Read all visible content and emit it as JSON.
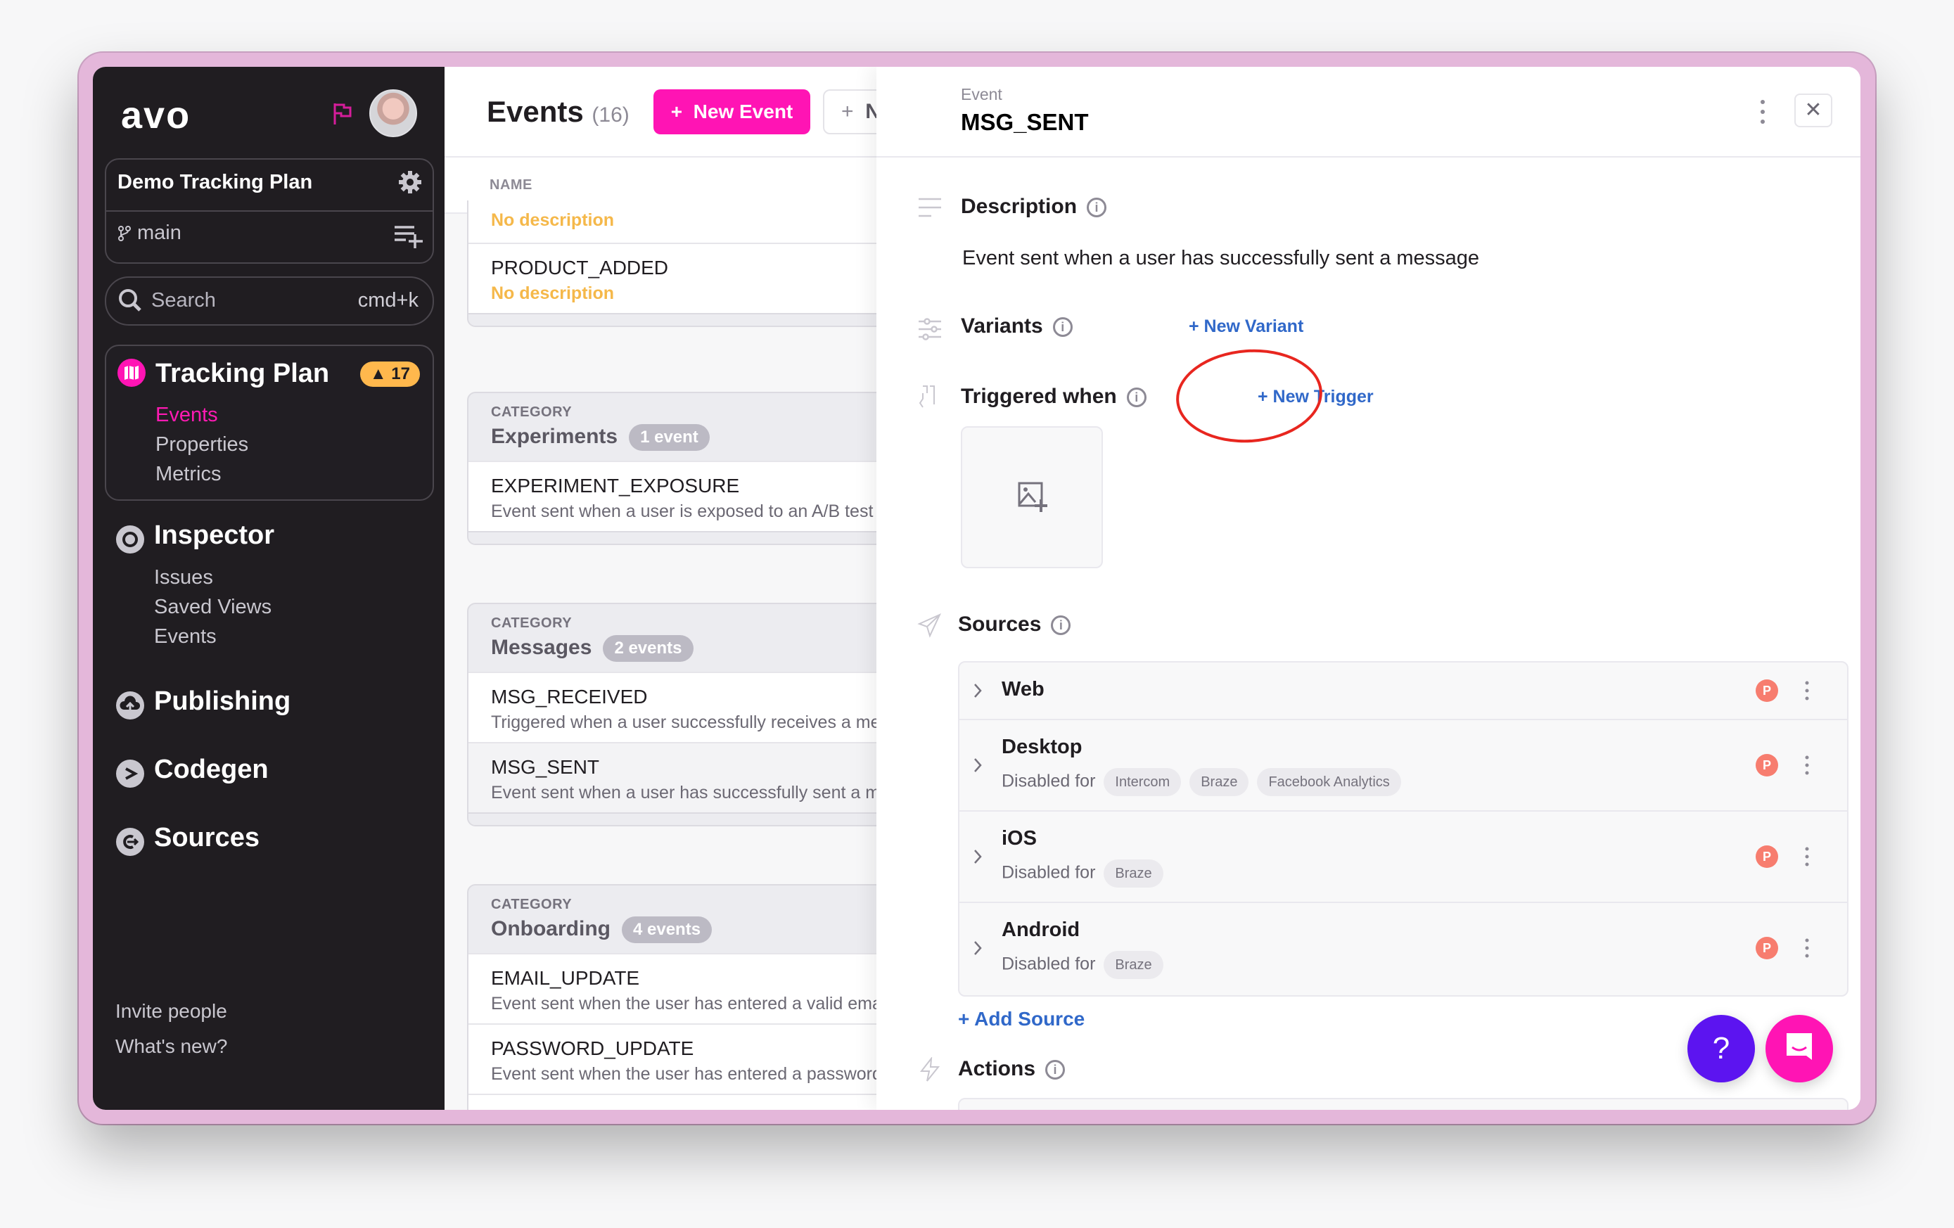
{
  "sidebar": {
    "logo": "avo",
    "plan_name": "Demo Tracking Plan",
    "branch": "main",
    "search": {
      "placeholder": "Search",
      "shortcut": "cmd+k"
    },
    "tracking_plan": {
      "title": "Tracking Plan",
      "issues_count": "17",
      "items": [
        {
          "label": "Events",
          "active": true
        },
        {
          "label": "Properties",
          "active": false
        },
        {
          "label": "Metrics",
          "active": false
        }
      ]
    },
    "inspector": {
      "title": "Inspector",
      "items": [
        {
          "label": "Issues"
        },
        {
          "label": "Saved Views"
        },
        {
          "label": "Events"
        }
      ]
    },
    "publishing": {
      "title": "Publishing"
    },
    "codegen": {
      "title": "Codegen"
    },
    "sources": {
      "title": "Sources"
    },
    "footer": {
      "invite": "Invite people",
      "whats_new": "What's new?"
    }
  },
  "events_list": {
    "title": "Events",
    "count": "(16)",
    "new_event_label": "New Event",
    "secondary_button_label": "N",
    "column_header": "NAME",
    "top_group": {
      "partial_desc": "No description",
      "events": [
        {
          "name": "PRODUCT_ADDED",
          "description": "No description",
          "no_description": true
        }
      ]
    },
    "categories": [
      {
        "label": "CATEGORY",
        "name": "Experiments",
        "count": "1 event",
        "events": [
          {
            "name": "EXPERIMENT_EXPOSURE",
            "description": "Event sent when a user is exposed to an A/B test"
          }
        ]
      },
      {
        "label": "CATEGORY",
        "name": "Messages",
        "count": "2 events",
        "events": [
          {
            "name": "MSG_RECEIVED",
            "description": "Triggered when a user successfully receives a message"
          },
          {
            "name": "MSG_SENT",
            "description": "Event sent when a user has successfully sent a message",
            "selected": true
          }
        ]
      },
      {
        "label": "CATEGORY",
        "name": "Onboarding",
        "count": "4 events",
        "events": [
          {
            "name": "EMAIL_UPDATE",
            "description": "Event sent when the user has entered a valid email"
          },
          {
            "name": "PASSWORD_UPDATE",
            "description": "Event sent when the user has entered a password"
          }
        ]
      }
    ]
  },
  "panel": {
    "kicker": "Event",
    "title": "MSG_SENT",
    "close_label": "✕",
    "description": {
      "label": "Description",
      "text": "Event sent when a user has successfully sent a message"
    },
    "variants": {
      "label": "Variants",
      "action": "+ New Variant"
    },
    "triggers": {
      "label": "Triggered when",
      "action": "+ New Trigger"
    },
    "sources": {
      "label": "Sources",
      "add_action": "+ Add Source",
      "disabled_prefix": "Disabled for",
      "items": [
        {
          "name": "Web",
          "badge": "P",
          "disabled_for": []
        },
        {
          "name": "Desktop",
          "badge": "P",
          "disabled_for": [
            "Intercom",
            "Braze",
            "Facebook Analytics"
          ]
        },
        {
          "name": "iOS",
          "badge": "P",
          "disabled_for": [
            "Braze"
          ]
        },
        {
          "name": "Android",
          "badge": "P",
          "disabled_for": [
            "Braze"
          ]
        }
      ]
    },
    "actions": {
      "label": "Actions"
    },
    "help_label": "?"
  },
  "colors": {
    "brand_pink": "#ff14b4",
    "sidebar_bg": "#201d21",
    "link_blue": "#3068c9",
    "warning": "#ffb84d",
    "annotation_red": "#e8261f",
    "help_purple": "#5c14f0",
    "frame_pink": "#e4b7da"
  }
}
